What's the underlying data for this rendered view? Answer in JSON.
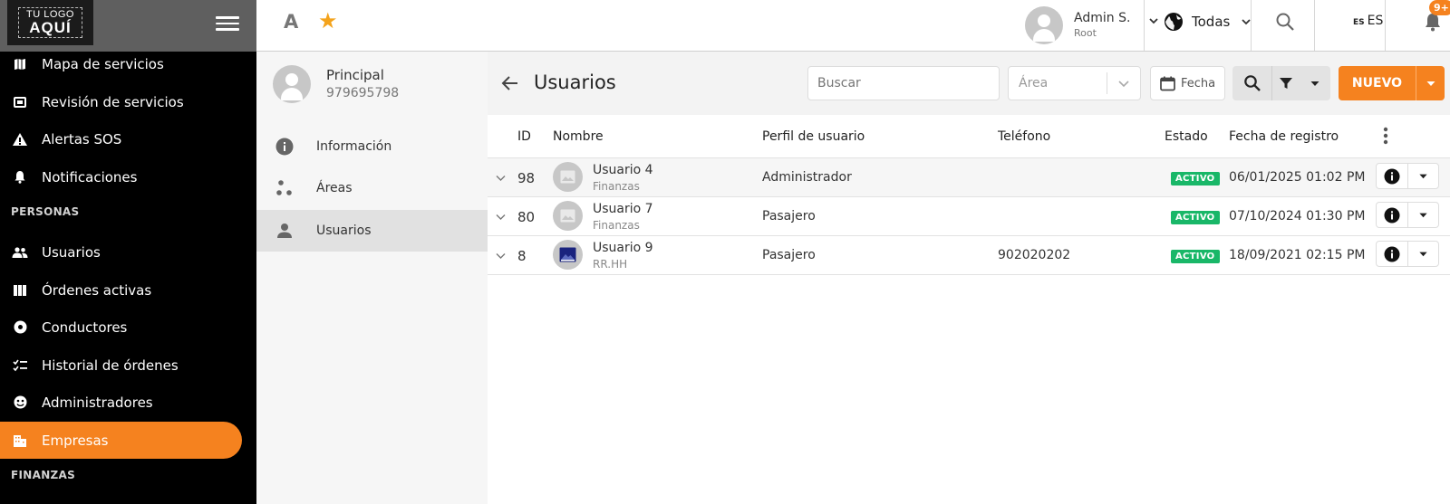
{
  "logo": {
    "line1": "TU LOGO",
    "line2": "AQUÍ"
  },
  "topbar": {
    "letter": "A",
    "user_name": "Admin S.",
    "user_role": "Root",
    "region_label": "Todas",
    "lang_small": "ES",
    "lang_label": "ES",
    "notif_count": "9+"
  },
  "sidebar": {
    "items": [
      {
        "label": "Mapa de servicios"
      },
      {
        "label": "Revisión de servicios"
      },
      {
        "label": "Alertas SOS"
      },
      {
        "label": "Notificaciones"
      },
      {
        "label": "Usuarios"
      },
      {
        "label": "Órdenes activas"
      },
      {
        "label": "Conductores"
      },
      {
        "label": "Historial de órdenes"
      },
      {
        "label": "Administradores"
      },
      {
        "label": "Empresas"
      }
    ],
    "section_personas": "PERSONAS",
    "section_finanzas": "FINANZAS"
  },
  "panel": {
    "title": "Principal",
    "subtitle": "979695798",
    "items": [
      {
        "label": "Información"
      },
      {
        "label": "Áreas"
      },
      {
        "label": "Usuarios"
      }
    ]
  },
  "main": {
    "title": "Usuarios",
    "search_placeholder": "Buscar",
    "area_placeholder": "Área",
    "date_label": "Fecha",
    "new_label": "NUEVO"
  },
  "table": {
    "headers": {
      "id": "ID",
      "name": "Nombre",
      "profile": "Perfil de usuario",
      "phone": "Teléfono",
      "status": "Estado",
      "date": "Fecha de registro"
    },
    "rows": [
      {
        "id": "98",
        "name": "Usuario 4",
        "area": "Finanzas",
        "profile": "Administrador",
        "phone": "",
        "status": "ACTIVO",
        "date": "06/01/2025 01:02 PM"
      },
      {
        "id": "80",
        "name": "Usuario 7",
        "area": "Finanzas",
        "profile": "Pasajero",
        "phone": "",
        "status": "ACTIVO",
        "date": "07/10/2024 01:30 PM"
      },
      {
        "id": "8",
        "name": "Usuario 9",
        "area": "RR.HH",
        "profile": "Pasajero",
        "phone": "902020202",
        "status": "ACTIVO",
        "date": "18/09/2021 02:15 PM"
      }
    ]
  },
  "colors": {
    "accent": "#f5821f",
    "status_active": "#19b768",
    "sidebar_bg": "#000000"
  }
}
